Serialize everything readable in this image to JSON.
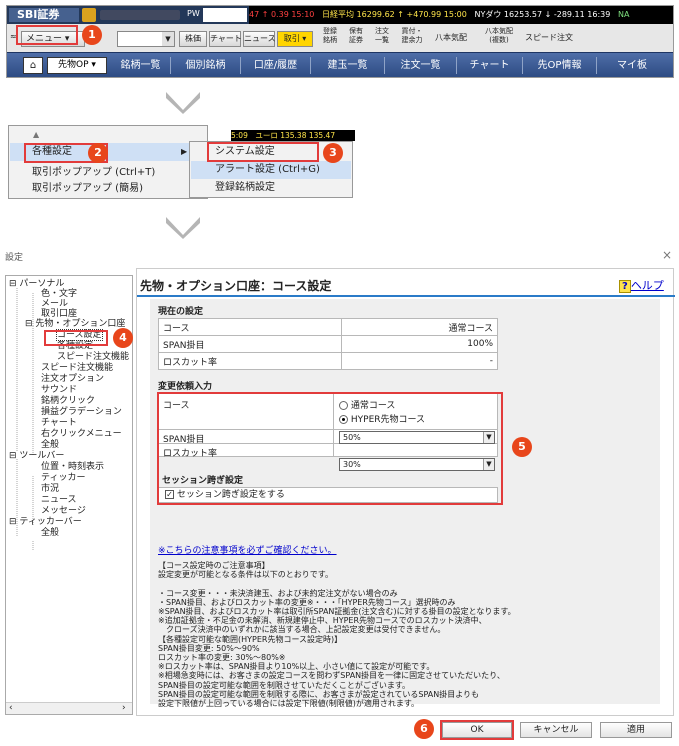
{
  "app": {
    "logo": "SBI証券",
    "pw_label": "PW",
    "ticker": {
      "t1": "47 ↑ 0.39 15:10",
      "t2": "日経平均 16299.62 ↑ +470.99 15:00",
      "t3": "NYダウ 16253.57 ↓ -289.11 16:39",
      "t4": "NA"
    },
    "menu_label": "メニュー",
    "toolbar": {
      "kabu": "株価",
      "chart": "チャート",
      "news": "ニュース",
      "torihiki": "取引",
      "s1": [
        "登録",
        "銘柄"
      ],
      "s2": [
        "保有",
        "証券"
      ],
      "s3": [
        "注文",
        "一覧"
      ],
      "s4": [
        "買付・",
        "建余力"
      ],
      "s5": "八本気配",
      "s6": [
        "八本気配",
        "(複数)"
      ],
      "s7": "スピード注文"
    },
    "nav": [
      "先物OP",
      "銘柄一覧",
      "個別銘柄",
      "口座/履歴",
      "建玉一覧",
      "注文一覧",
      "チャート",
      "先OP情報",
      "マイ板"
    ]
  },
  "menu": {
    "ticker_small": "5:09　ユーロ 135.38 135.47",
    "items": [
      "各種設定",
      "取引ポップアップ (Ctrl+T)",
      "取引ポップアップ (簡易)"
    ],
    "submenu": [
      "システム設定",
      "アラート設定 (Ctrl+G)",
      "登録銘柄設定"
    ]
  },
  "badges": [
    "1",
    "2",
    "3",
    "4",
    "5",
    "6"
  ],
  "dialog": {
    "title": "設定",
    "close": "×",
    "tree": {
      "personal": "パーソナル",
      "p_items": [
        "色・文字",
        "メール",
        "取引口座"
      ],
      "futop": "先物・オプション口座",
      "futop_items": [
        "コース設定",
        "各種設定",
        "スピード注文機能"
      ],
      "p_items2": [
        "スピード注文機能",
        "注文オプション",
        "サウンド",
        "銘柄クリック",
        "損益グラデーション",
        "チャート",
        "右クリックメニュー",
        "全般"
      ],
      "toolbar": "ツールバー",
      "tb_items": [
        "位置・時刻表示",
        "ティッカー",
        "市況",
        "ニュース",
        "メッセージ"
      ],
      "ticker": "ティッカーバー",
      "tk_items": [
        "全般"
      ]
    },
    "heading": "先物・オプション口座：コース設定",
    "help_q": "?",
    "help_label": "ヘルプ",
    "current": {
      "title": "現在の設定",
      "rows": [
        {
          "label": "コース",
          "value": "通常コース"
        },
        {
          "label": "SPAN掛目",
          "value": "100%"
        },
        {
          "label": "ロスカット率",
          "value": "-"
        }
      ]
    },
    "change": {
      "title": "変更依頼入力",
      "course_label": "コース",
      "opt1": "通常コース",
      "opt2": "HYPER先物コース",
      "span_label": "SPAN掛目",
      "span_value": "50%",
      "losscut_label": "ロスカット率",
      "losscut_value": "30%"
    },
    "session": {
      "title": "セッション跨ぎ設定",
      "check_label": "セッション跨ぎ設定をする"
    },
    "link": "※こちらの注意事項を必ずご確認ください。",
    "notes": [
      "【コース設定時のご注意事項】",
      "設定変更が可能となる条件は以下のとおりです。",
      "",
      "・コース変更・・・未決済建玉、および未約定注文がない場合のみ",
      "・SPAN掛目、およびロスカット率の変更※・・・「HYPER先物コース」選択時のみ",
      "※SPAN掛目、およびロスカット率は取引所SPAN証拠金(注文含む)に対する掛目の設定となります。",
      "※追加証拠金・不足金の未解消、新規建停止中、HYPER先物コースでのロスカット決済中、",
      "　クローズ決済中のいずれかに該当する場合、上記設定変更は受付できません。",
      "【各種設定可能な範囲(HYPER先物コース設定時)】",
      "SPAN掛目変更: 50%～90%",
      "ロスカット率の変更: 30%～80%※",
      "※ロスカット率は、SPAN掛目より10%以上、小さい値にて設定が可能です。",
      "※相場急変時には、お客さまの設定コースを問わずSPAN掛目を一律に固定させていただいたり、",
      "SPAN掛目の設定可能な範囲を制限させていただくことがございます。",
      "SPAN掛目の設定可能な範囲を制限する際に、お客さまが設定されているSPAN掛目よりも",
      "設定下限値が上回っている場合には設定下限値(制限値)が適用されます。"
    ],
    "buttons": {
      "ok": "OK",
      "cancel": "キャンセル",
      "apply": "適用"
    }
  }
}
